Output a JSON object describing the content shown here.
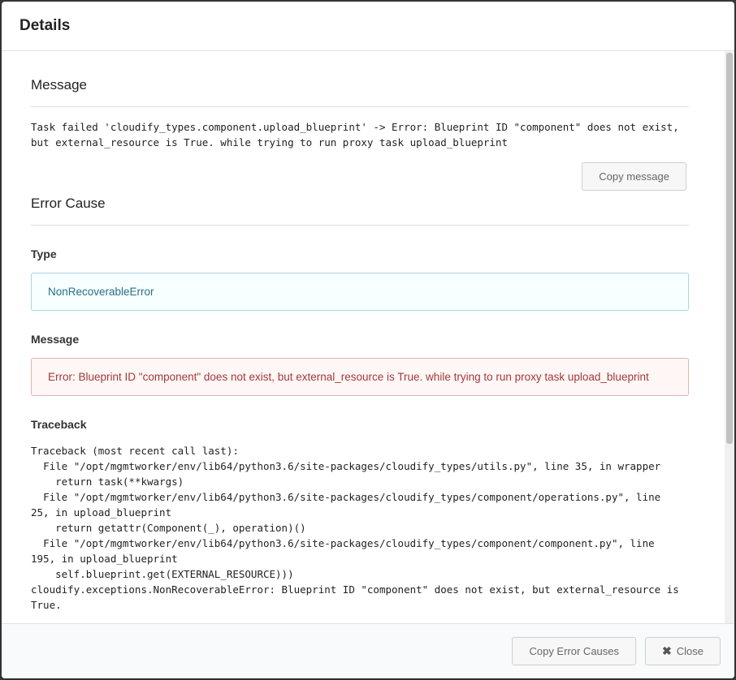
{
  "modal": {
    "title": "Details"
  },
  "message_section": {
    "heading": "Message",
    "text": "Task failed 'cloudify_types.component.upload_blueprint' -> Error: Blueprint ID \"component\" does not exist,\nbut external_resource is True. while trying to run proxy task upload_blueprint",
    "copy_button": "Copy message"
  },
  "error_cause": {
    "heading": "Error Cause",
    "type_label": "Type",
    "type_value": "NonRecoverableError",
    "message_label": "Message",
    "message_value": "Error: Blueprint ID \"component\" does not exist, but external_resource is True. while trying to run proxy task upload_blueprint",
    "traceback_label": "Traceback",
    "traceback_text": "Traceback (most recent call last):\n  File \"/opt/mgmtworker/env/lib64/python3.6/site-packages/cloudify_types/utils.py\", line 35, in wrapper\n    return task(**kwargs)\n  File \"/opt/mgmtworker/env/lib64/python3.6/site-packages/cloudify_types/component/operations.py\", line\n25, in upload_blueprint\n    return getattr(Component(_), operation)()\n  File \"/opt/mgmtworker/env/lib64/python3.6/site-packages/cloudify_types/component/component.py\", line\n195, in upload_blueprint\n    self.blueprint.get(EXTERNAL_RESOURCE)))\ncloudify.exceptions.NonRecoverableError: Blueprint ID \"component\" does not exist, but external_resource is\nTrue."
  },
  "footer": {
    "copy_causes_button": "Copy Error Causes",
    "close_button": "Close",
    "close_icon": "close-icon"
  },
  "colors": {
    "info_bg": "#f8ffff",
    "info_text": "#276f86",
    "error_bg": "#fff6f6",
    "error_text": "#9f3a38"
  }
}
